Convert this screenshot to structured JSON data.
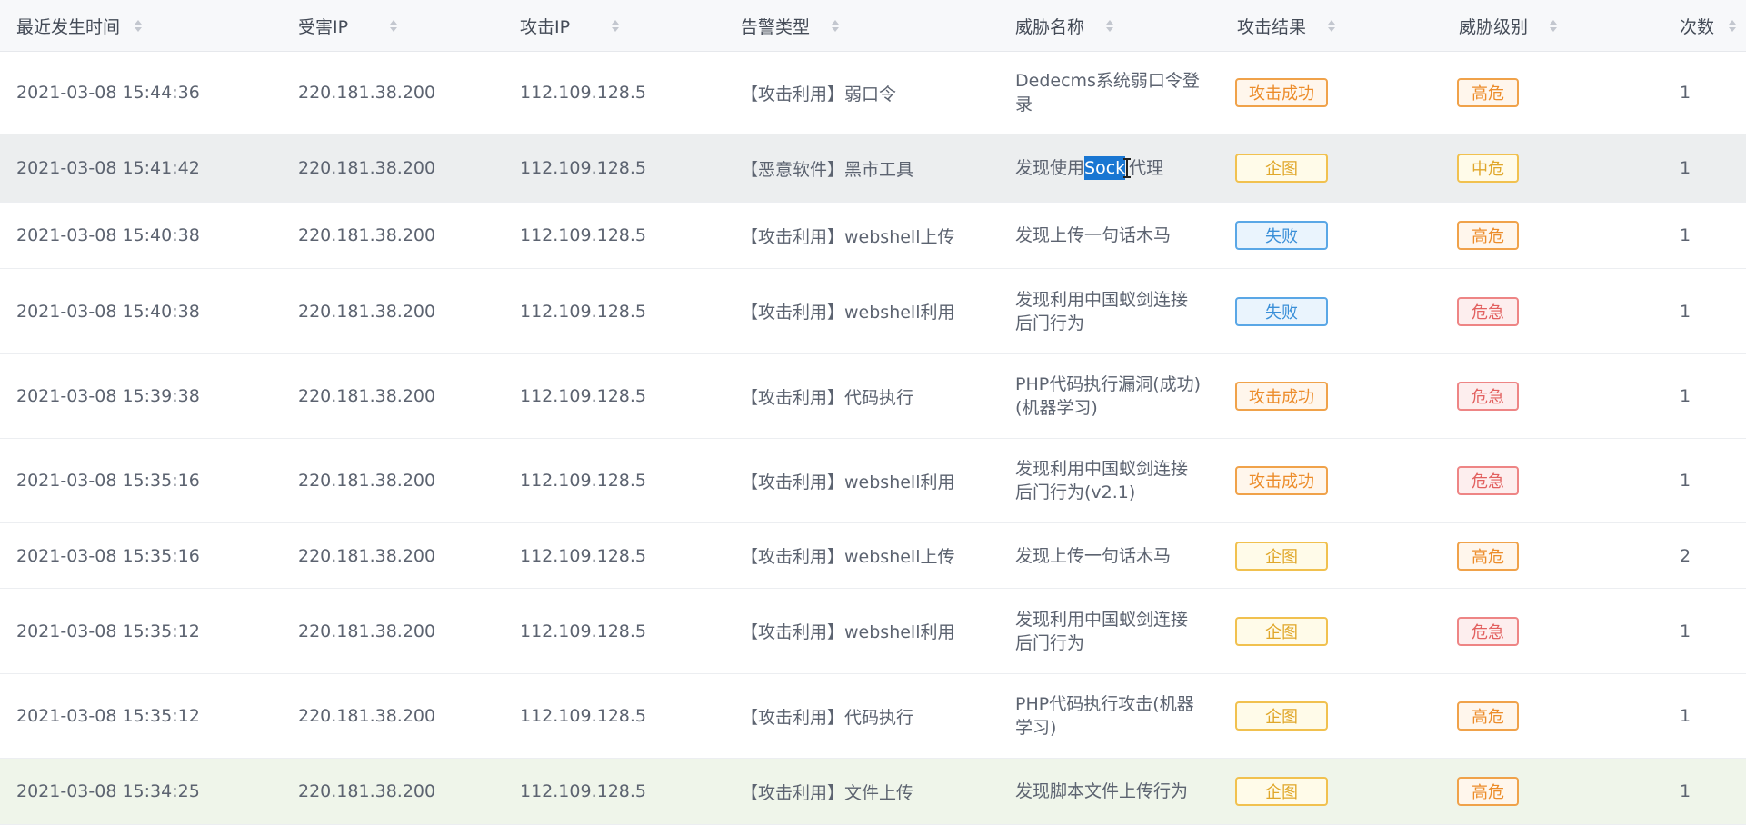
{
  "headers": {
    "time": "最近发生时间",
    "victim": "受害IP",
    "attacker": "攻击IP",
    "alert_type": "告警类型",
    "threat": "威胁名称",
    "result": "攻击结果",
    "level": "威胁级别",
    "count": "次数"
  },
  "rows": [
    {
      "time": "2021-03-08 15:44:36",
      "victim": "220.181.38.200",
      "attacker": "112.109.128.5",
      "alert_type": "【攻击利用】弱口令",
      "threat_l1": "Dedecms系统弱口令登",
      "threat_l2": "录",
      "result": "攻击成功",
      "level": "高危",
      "count": "1"
    },
    {
      "time": "2021-03-08 15:41:42",
      "victim": "220.181.38.200",
      "attacker": "112.109.128.5",
      "alert_type": "【恶意软件】黑市工具",
      "threat_pre": "发现使用",
      "threat_sel": "Sock",
      "threat_post": "代理",
      "result": "企图",
      "level": "中危",
      "count": "1"
    },
    {
      "time": "2021-03-08 15:40:38",
      "victim": "220.181.38.200",
      "attacker": "112.109.128.5",
      "alert_type": "【攻击利用】webshell上传",
      "threat_l1": "发现上传一句话木马",
      "threat_l2": "",
      "result": "失败",
      "level": "高危",
      "count": "1"
    },
    {
      "time": "2021-03-08 15:40:38",
      "victim": "220.181.38.200",
      "attacker": "112.109.128.5",
      "alert_type": "【攻击利用】webshell利用",
      "threat_l1": "发现利用中国蚁剑连接",
      "threat_l2": "后门行为",
      "result": "失败",
      "level": "危急",
      "count": "1"
    },
    {
      "time": "2021-03-08 15:39:38",
      "victim": "220.181.38.200",
      "attacker": "112.109.128.5",
      "alert_type": "【攻击利用】代码执行",
      "threat_l1": "PHP代码执行漏洞(成功)",
      "threat_l2": "(机器学习)",
      "result": "攻击成功",
      "level": "危急",
      "count": "1"
    },
    {
      "time": "2021-03-08 15:35:16",
      "victim": "220.181.38.200",
      "attacker": "112.109.128.5",
      "alert_type": "【攻击利用】webshell利用",
      "threat_l1": "发现利用中国蚁剑连接",
      "threat_l2": "后门行为(v2.1)",
      "result": "攻击成功",
      "level": "危急",
      "count": "1"
    },
    {
      "time": "2021-03-08 15:35:16",
      "victim": "220.181.38.200",
      "attacker": "112.109.128.5",
      "alert_type": "【攻击利用】webshell上传",
      "threat_l1": "发现上传一句话木马",
      "threat_l2": "",
      "result": "企图",
      "level": "高危",
      "count": "2"
    },
    {
      "time": "2021-03-08 15:35:12",
      "victim": "220.181.38.200",
      "attacker": "112.109.128.5",
      "alert_type": "【攻击利用】webshell利用",
      "threat_l1": "发现利用中国蚁剑连接",
      "threat_l2": "后门行为",
      "result": "企图",
      "level": "危急",
      "count": "1"
    },
    {
      "time": "2021-03-08 15:35:12",
      "victim": "220.181.38.200",
      "attacker": "112.109.128.5",
      "alert_type": "【攻击利用】代码执行",
      "threat_l1": "PHP代码执行攻击(机器",
      "threat_l2": "学习)",
      "result": "企图",
      "level": "高危",
      "count": "1"
    },
    {
      "time": "2021-03-08 15:34:25",
      "victim": "220.181.38.200",
      "attacker": "112.109.128.5",
      "alert_type": "【攻击利用】文件上传",
      "threat_l1": "发现脚本文件上传行为",
      "threat_l2": "",
      "result": "企图",
      "level": "高危",
      "count": "1"
    }
  ]
}
